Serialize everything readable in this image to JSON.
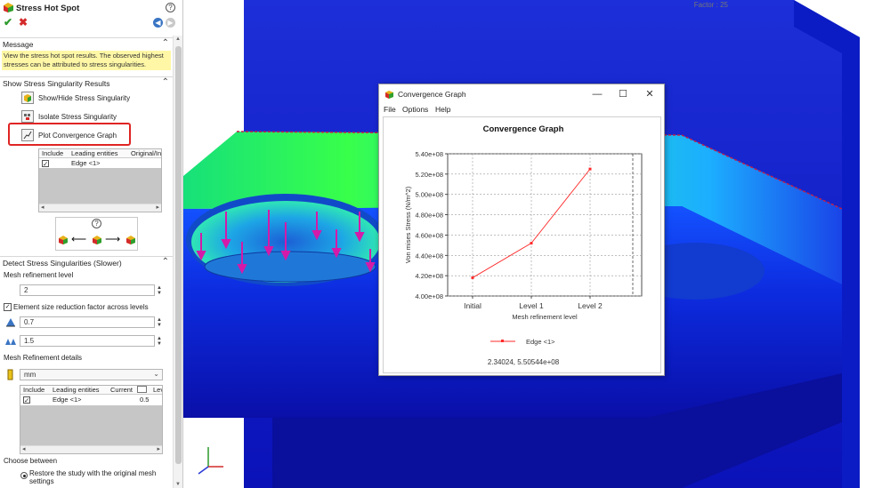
{
  "property_manager": {
    "title": "Stress Hot Spot",
    "help_glyph": "?",
    "ok_glyph": "✔",
    "cancel_glyph": "✖",
    "back_glyph": "◀",
    "forward_glyph": "▶",
    "message": {
      "header": "Message",
      "text": "View the stress hot spot results. The observed highest stresses can be attributed to stress singularities."
    },
    "show_results": {
      "header": "Show Stress Singularity Results",
      "options": [
        "Show/Hide Stress Singularity",
        "Isolate Stress Singularity",
        "Plot Convergence Graph"
      ],
      "table": {
        "columns": [
          "Include",
          "Leading entities",
          "Original/In"
        ],
        "rows": [
          {
            "include": true,
            "entity": "Edge <1>"
          }
        ]
      }
    },
    "detect": {
      "header": "Detect Stress Singularities (Slower)",
      "mesh_refinement_level_label": "Mesh refinement level",
      "mesh_refinement_level": "2",
      "size_factor_label": "Element size reduction factor across levels",
      "size_factor_checked": true,
      "factor_a": "0.7",
      "factor_b": "1.5",
      "mesh_details_label": "Mesh Refinement details",
      "unit": "mm",
      "table": {
        "columns": [
          "Include",
          "Leading entities",
          "Current",
          "Leve"
        ],
        "rows": [
          {
            "include": true,
            "entity": "Edge <1>",
            "current": "0.5"
          }
        ]
      },
      "choose_between_label": "Choose between",
      "restore_option": "Restore the study with the original mesh settings"
    }
  },
  "viewport": {
    "factor_label": "Factor : 25"
  },
  "convergence_dialog": {
    "title": "Convergence Graph",
    "menu": [
      "File",
      "Options",
      "Help"
    ],
    "readout": "2.34024, 5.50544e+08"
  },
  "chart_data": {
    "type": "line",
    "title": "Convergence Graph",
    "xlabel": "Mesh refinement level",
    "ylabel": "Von mises Stress (N/m^2)",
    "categories": [
      "Initial",
      "Level 1",
      "Level 2"
    ],
    "series": [
      {
        "name": "Edge <1>",
        "color": "#ff2a2a",
        "values": [
          418000000,
          452000000,
          525000000
        ]
      }
    ],
    "ylim": [
      400000000,
      540000000
    ],
    "yticks": [
      "4.00e+08",
      "4.20e+08",
      "4.40e+08",
      "4.60e+08",
      "4.80e+08",
      "5.00e+08",
      "5.20e+08",
      "5.40e+08"
    ],
    "grid": true,
    "legend_position": "bottom"
  },
  "colors": {
    "accent_red": "#e02424",
    "message_yellow": "#fff7a6",
    "series_red": "#ff2a2a"
  }
}
